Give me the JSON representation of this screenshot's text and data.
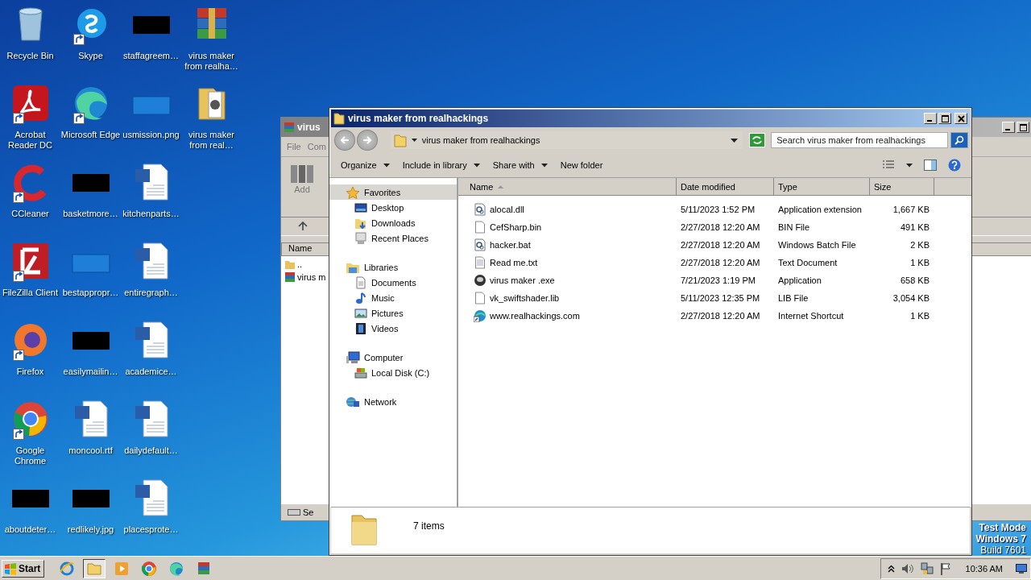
{
  "desktop_icons": [
    {
      "label": "Recycle Bin",
      "kind": "recycle",
      "shortcut": false
    },
    {
      "label": "Acrobat Reader DC",
      "kind": "acrobat",
      "shortcut": true
    },
    {
      "label": "CCleaner",
      "kind": "ccleaner",
      "shortcut": true
    },
    {
      "label": "FileZilla Client",
      "kind": "filezilla",
      "shortcut": true
    },
    {
      "label": "Firefox",
      "kind": "firefox",
      "shortcut": true
    },
    {
      "label": "Google Chrome",
      "kind": "chrome",
      "shortcut": true
    },
    {
      "label": "aboutdeter…",
      "kind": "thumb_black",
      "shortcut": false
    },
    {
      "label": "Skype",
      "kind": "skype",
      "shortcut": true
    },
    {
      "label": "Microsoft Edge",
      "kind": "edge",
      "shortcut": true
    },
    {
      "label": "basketmore…",
      "kind": "thumb_black",
      "shortcut": false
    },
    {
      "label": "bestappropr…",
      "kind": "thumb_blank",
      "shortcut": false
    },
    {
      "label": "easilymailin…",
      "kind": "thumb_black",
      "shortcut": false
    },
    {
      "label": "moncool.rtf",
      "kind": "word",
      "shortcut": false
    },
    {
      "label": "redlikely.jpg",
      "kind": "thumb_black",
      "shortcut": false
    },
    {
      "label": "staffagreem…",
      "kind": "thumb_black",
      "shortcut": false
    },
    {
      "label": "usmission.png",
      "kind": "thumb_blank",
      "shortcut": false
    },
    {
      "label": "kitchenparts…",
      "kind": "word",
      "shortcut": false
    },
    {
      "label": "entiregraph…",
      "kind": "word",
      "shortcut": false
    },
    {
      "label": "academice…",
      "kind": "word",
      "shortcut": false
    },
    {
      "label": "dailydefault…",
      "kind": "word",
      "shortcut": false
    },
    {
      "label": "placesprote…",
      "kind": "word",
      "shortcut": false
    },
    {
      "label": "virus maker from realha…",
      "kind": "winrar",
      "shortcut": false
    },
    {
      "label": "virus maker from real…",
      "kind": "folder",
      "shortcut": false
    }
  ],
  "background_window": {
    "title": "virus",
    "menu": [
      "File",
      "Com"
    ],
    "toolbar_button": "Add",
    "column": "Name",
    "rows": [
      {
        "label": "..",
        "kind": "up"
      },
      {
        "label": "virus m",
        "kind": "archive"
      }
    ],
    "status": "Se"
  },
  "explorer": {
    "title": "virus maker from realhackings",
    "address": "virus maker from realhackings",
    "search": {
      "placeholder": "Search virus maker from realhackings"
    },
    "toolbar": [
      {
        "label": "Organize",
        "dropdown": true
      },
      {
        "label": "Include in library",
        "dropdown": true
      },
      {
        "label": "Share with",
        "dropdown": true
      },
      {
        "label": "New folder",
        "dropdown": false
      }
    ],
    "nav": [
      {
        "label": "Favorites",
        "kind": "star",
        "selected": true,
        "children": [
          {
            "label": "Desktop",
            "kind": "desktop",
            "selected": false
          },
          {
            "label": "Downloads",
            "kind": "downloads",
            "selected": false
          },
          {
            "label": "Recent Places",
            "kind": "recent",
            "selected": false
          }
        ]
      },
      {
        "label": "Libraries",
        "kind": "library",
        "selected": false,
        "children": [
          {
            "label": "Documents",
            "kind": "documents",
            "selected": false
          },
          {
            "label": "Music",
            "kind": "music",
            "selected": false
          },
          {
            "label": "Pictures",
            "kind": "pictures",
            "selected": false
          },
          {
            "label": "Videos",
            "kind": "videos",
            "selected": false
          }
        ]
      },
      {
        "label": "Computer",
        "kind": "computer",
        "selected": false,
        "children": [
          {
            "label": "Local Disk (C:)",
            "kind": "disk",
            "selected": false
          }
        ]
      },
      {
        "label": "Network",
        "kind": "network",
        "selected": false
      }
    ],
    "columns": [
      {
        "label": "Name",
        "sorted": true
      },
      {
        "label": "Date modified",
        "sorted": false
      },
      {
        "label": "Type",
        "sorted": false
      },
      {
        "label": "Size",
        "sorted": false
      }
    ],
    "files": [
      {
        "name": "alocal.dll",
        "date": "5/11/2023 1:52 PM",
        "type": "Application extension",
        "size": "1,667 KB",
        "kind": "gear"
      },
      {
        "name": "CefSharp.bin",
        "date": "2/27/2018 12:20 AM",
        "type": "BIN File",
        "size": "491 KB",
        "kind": "blank"
      },
      {
        "name": "hacker.bat",
        "date": "2/27/2018 12:20 AM",
        "type": "Windows Batch File",
        "size": "2 KB",
        "kind": "gear"
      },
      {
        "name": "Read me.txt",
        "date": "2/27/2018 12:20 AM",
        "type": "Text Document",
        "size": "1 KB",
        "kind": "text"
      },
      {
        "name": "virus maker .exe",
        "date": "7/21/2023 1:19 PM",
        "type": "Application",
        "size": "658 KB",
        "kind": "app"
      },
      {
        "name": "vk_swiftshader.lib",
        "date": "5/11/2023 12:35 PM",
        "type": "LIB File",
        "size": "3,054 KB",
        "kind": "blank"
      },
      {
        "name": "www.realhackings.com",
        "date": "2/27/2018 12:20 AM",
        "type": "Internet Shortcut",
        "size": "1 KB",
        "kind": "link"
      }
    ],
    "status": "7 items"
  },
  "test_mode": [
    {
      "text": "Test Mode",
      "bold": true
    },
    {
      "text": "Windows 7",
      "bold": true
    },
    {
      "text": "Build 7601",
      "bold": false
    }
  ],
  "taskbar": {
    "start": "Start",
    "apps": [
      {
        "kind": "ie",
        "active": false
      },
      {
        "kind": "explorer",
        "active": true
      },
      {
        "kind": "media",
        "active": false
      },
      {
        "kind": "chrome",
        "active": false
      },
      {
        "kind": "edge",
        "active": false
      },
      {
        "kind": "winrar",
        "active": false
      }
    ],
    "clock": "10:36 AM"
  }
}
